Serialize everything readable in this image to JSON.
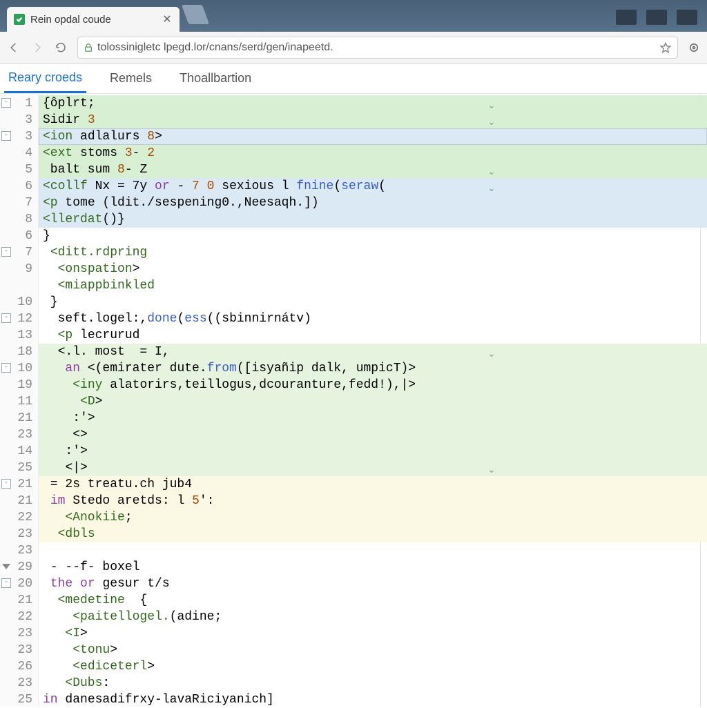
{
  "browser": {
    "tab_title": "Rein opdal coude",
    "url": "tolossinigletc lpegd.lor/cnans/serd/gen/inapeetd."
  },
  "subtabs": {
    "items": [
      "Reary croeds",
      "Remels",
      "Thoallbartion"
    ],
    "active_index": 0
  },
  "gutter_numbers": [
    "1",
    "3",
    "3",
    "4",
    "5",
    "6",
    "7",
    "8",
    "6",
    "7",
    "9",
    "",
    "10",
    "12",
    "13",
    "18",
    "10",
    "19",
    "11",
    "21",
    "23",
    "14",
    "25",
    "21",
    "21",
    "22",
    "23",
    "23",
    "29",
    "20",
    "21",
    "22",
    "23",
    "23",
    "26",
    "23",
    "25"
  ],
  "fold_markers": {
    "0": "box",
    "2": "box",
    "9": "box",
    "13": "box",
    "16": "box",
    "23": "box",
    "28": "tri",
    "29": "box"
  },
  "code": {
    "l1": "{ôplrt;",
    "l2": "Sidir 3",
    "l3": "<ion adlalurs 8>",
    "l4": "<ext stoms 3- 2",
    "l5": " balt sum 8- Z",
    "l6": "<collf Nx = 7y or - 7 0 sexious l fnine(seraw(",
    "l7": "<p tome (ldit./sespening0.,Neesaqh.])",
    "l8": "<llerdat()}",
    "l9": "}",
    "l10": " <ditt.rdpring",
    "l11": "  <onspation>",
    "l12": "  <miappbinkled",
    "l13": " }",
    "l14": "  seft.logel:,done(ess((sbinnirnátv)",
    "l15": "  <p lecrurud",
    "l16": "  <.l. most  = I,",
    "l17": "   an <(emirater dute.from([isyañip dalk, umpicT)>",
    "l18": "    <iny alatorirs,teillogus,dcouranture,fedd!),|>",
    "l19": "     <D>",
    "l20": "    :'>",
    "l21": "    <>",
    "l22": "   :'>",
    "l23": "   <|>",
    "l24": " = 2s treatu.ch jub4",
    "l25": " im Stedo aretds: l 5':",
    "l26": "   <Anokiie;",
    "l27": "  <dbls",
    "l28": "",
    "l29": " - --f- boxel",
    "l30": " the or gesur t/s",
    "l31": "  <medetine  {",
    "l32": "    <paitellogel.(adine;",
    "l33": "   <I>",
    "l34": "    <tonu>",
    "l35": "    <ediceterl>",
    "l36": "   <Dubs:",
    "l37": "in danesadifrxy-lavaRiciyanich]"
  },
  "chevron_lines": [
    0,
    1,
    4,
    5,
    15,
    22
  ]
}
